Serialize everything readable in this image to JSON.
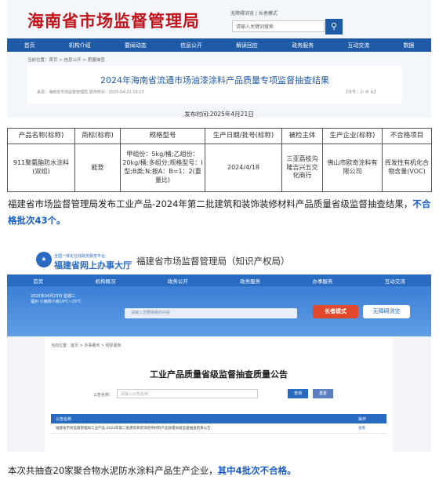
{
  "hainan": {
    "logo": "海南省市场监督管理局",
    "top_links": "无障碍浏览 | 长者模式",
    "search_placeholder": "请输入关键词搜索",
    "nav": [
      "首页",
      "机构介绍",
      "要闻动态",
      "信息公开",
      "解读回应",
      "政务服务",
      "互动交流",
      "数据"
    ],
    "breadcrumb": "当前位置：首页 > 信息公开 > 质量抽查",
    "article_title": "2024年海南省流通市场油漆涂料产品质量专项监督抽查结果",
    "article_meta": "来源：海南省市场监督管理局     发布时间：2025-04-21 10:13",
    "font_size": "【字号：小 中 大】",
    "publish_date": "发布时间:2025年4月21日"
  },
  "table": {
    "headers": [
      "产品名称(标称)",
      "商标(标称)",
      "规格型号",
      "生产日期/批号(标称)",
      "被检主体",
      "生产企业(标称)",
      "不合格项目"
    ],
    "row": [
      "911聚氨酯防水涂料(双组)",
      "能登",
      "甲组份：5kg/桶;乙组份：20kg/桶;多组分;规格型号：I型;B类;N;按A：B=1：2(重量比)",
      "2024/4/18",
      "三亚荔枝沟隆吉兴五交化商行",
      "佛山市欧奇涂料有限公司",
      "挥发性有机化合物含量(VOC)"
    ]
  },
  "para1": {
    "text": "福建省市场监督管理局发布工业产品-2024年第二批建筑和装饰装修材料产品质量省级监督抽查结果，",
    "highlight": "不合格批次43个。"
  },
  "fujian": {
    "brand_top": "全国一体化在线政务服务平台",
    "brand": "福建省网上办事大厅",
    "bureau": "福建省市场监督管理局（知识产权局）",
    "nav": [
      "首页",
      "机构概况",
      "政务公开",
      "政务服务",
      "办事服务",
      "互动交流"
    ],
    "banner_date": "2025年04月23日 星期三\n福州 小雨转小雨19℃~25℃",
    "search_placeholder": "请输入您要搜索的内容",
    "elder_mode": "长者模式",
    "accessible": "无障碍浏览",
    "breadcrumb": "当前位置：首页 > 办事服务 > 便民服务",
    "title": "工业产品质量省级监督抽查质量公告",
    "query_label": "公告名称：",
    "query_placeholder": "请输入公告名称",
    "query_btn": "查询",
    "reset_btn": "重置",
    "th_name": "公告名称",
    "th_op": "操作",
    "row_text": "福建省市场监督管理局工业产品-2024年第二批建筑和装饰装修材料产品质量省级监督抽查结果公告",
    "row_op": "查看"
  },
  "para2": {
    "text": "本次共抽查20家聚合物水泥防水涂料产品生产企业，",
    "highlight": "其中4批次不合格。"
  }
}
